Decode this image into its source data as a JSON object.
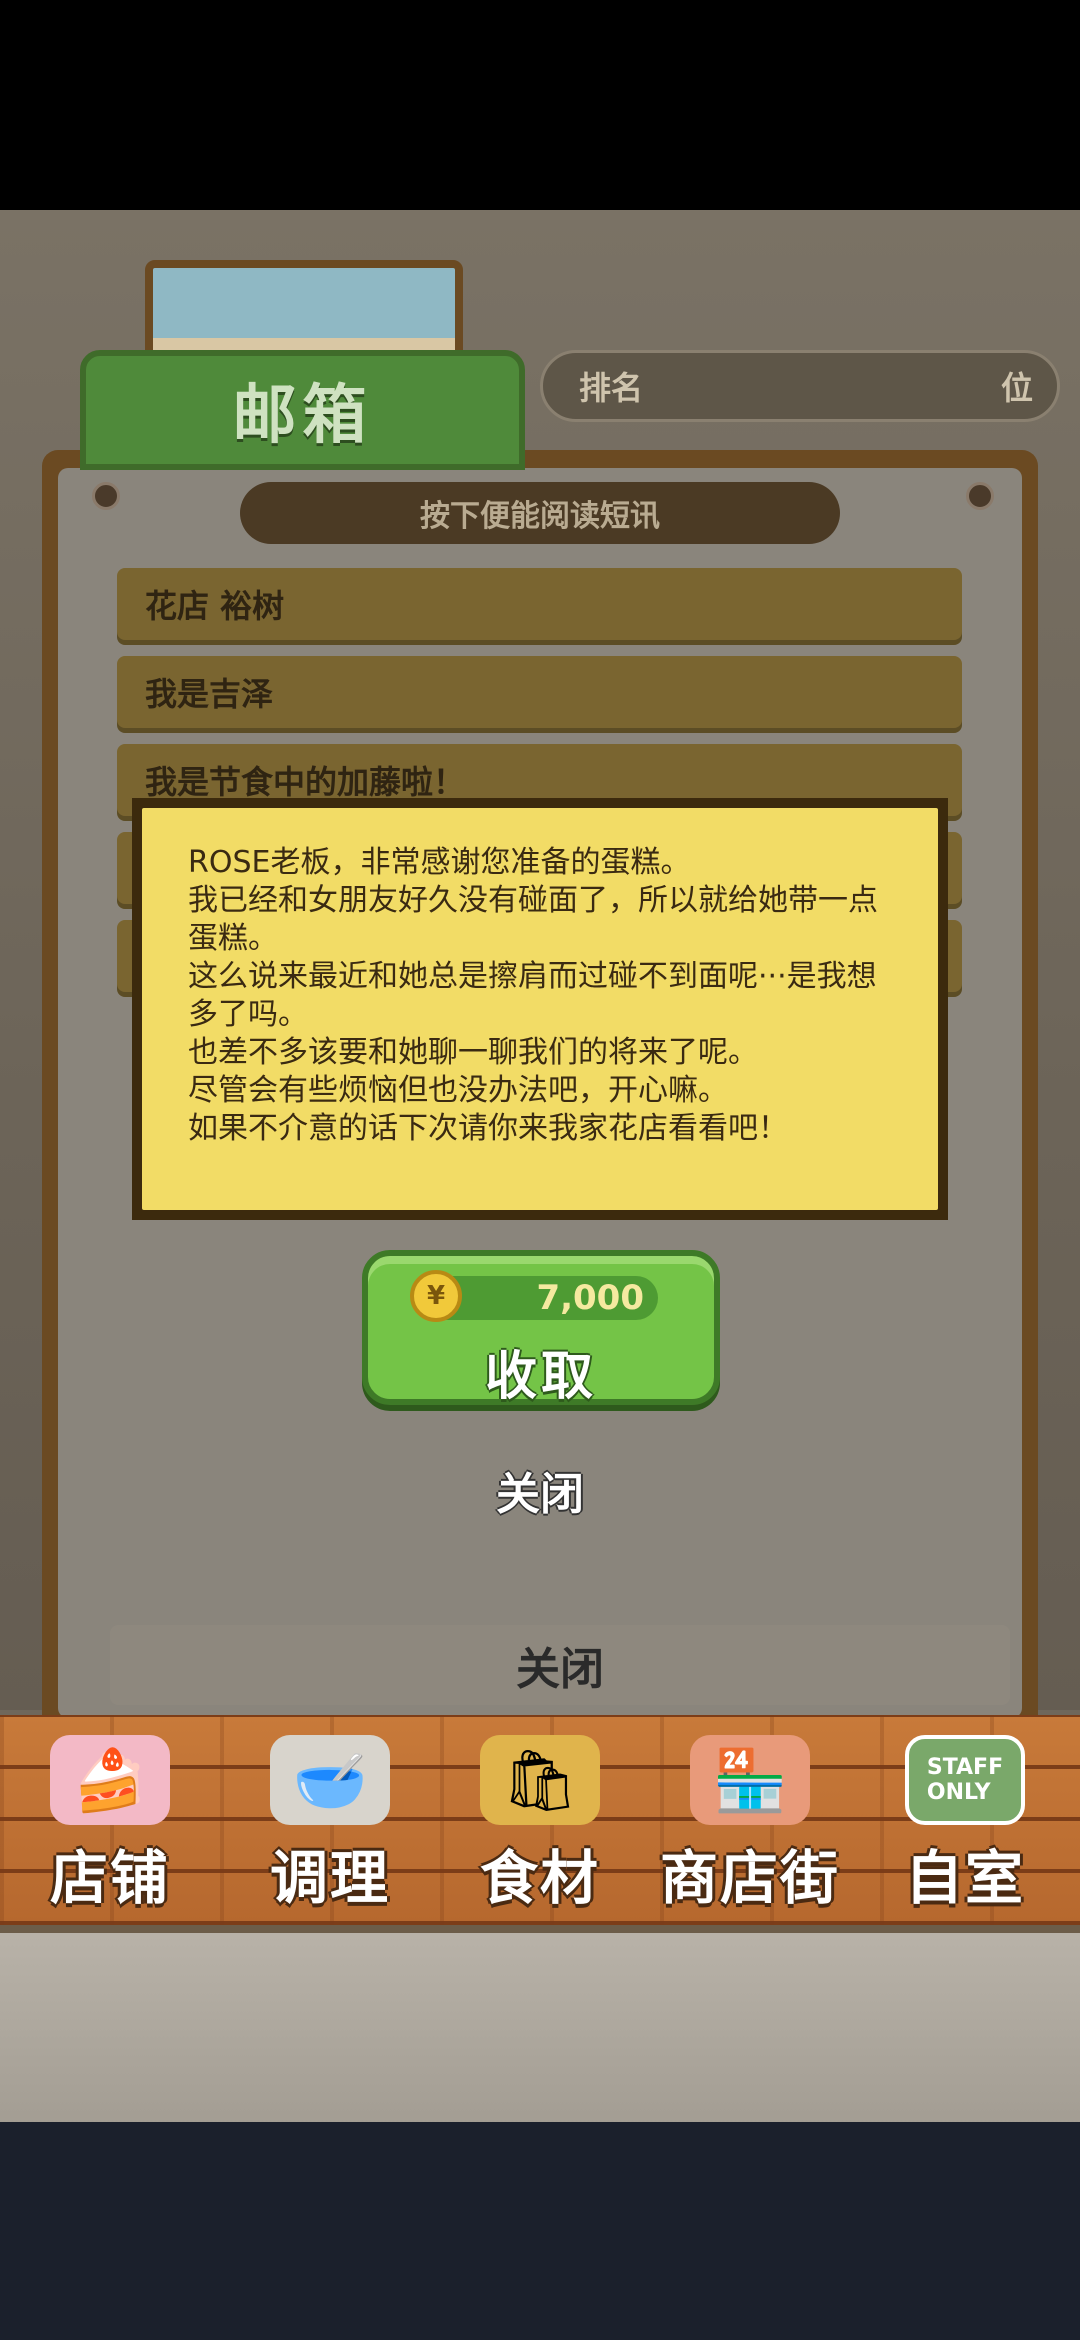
{
  "header": {
    "mail_tab_title": "邮箱",
    "ranking_label": "排名",
    "ranking_unit": "位"
  },
  "mailbox": {
    "hint": "按下便能阅读短讯",
    "items": [
      {
        "label": "花店 裕树"
      },
      {
        "label": "我是吉泽"
      },
      {
        "label": "我是节食中的加藤啦！"
      }
    ],
    "footer_close": "关闭"
  },
  "message_popup": {
    "text": "ROSE老板，非常感谢您准备的蛋糕。\n我已经和女朋友好久没有碰面了，所以就给她带一点蛋糕。\n这么说来最近和她总是擦肩而过碰不到面呢···是我想多了吗。\n也差不多该要和她聊一聊我们的将来了呢。\n尽管会有些烦恼但也没办法吧，开心嘛。\n如果不介意的话下次请你来我家花店看看吧！",
    "reward_amount": "7,000",
    "coin_symbol": "¥",
    "collect_label": "收取",
    "close_label": "关闭"
  },
  "navbar": {
    "items": [
      {
        "label": "店铺",
        "icon": "cake-icon"
      },
      {
        "label": "调理",
        "icon": "mixing-bowl-icon"
      },
      {
        "label": "食材",
        "icon": "flour-sack-icon"
      },
      {
        "label": "商店街",
        "icon": "shop-icon"
      },
      {
        "label": "自室",
        "icon": "staff-only-sign-icon"
      }
    ]
  }
}
